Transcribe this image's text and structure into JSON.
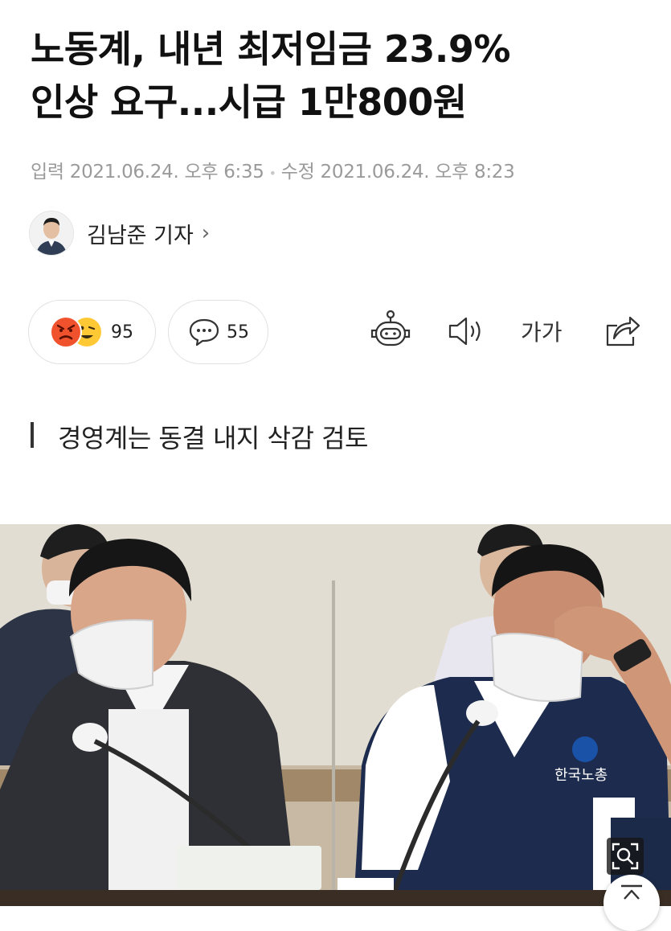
{
  "article": {
    "title_line1": "노동계, 내년 최저임금 23.9%",
    "title_line2": "인상 요구...시급 1만800원",
    "meta": {
      "input_label": "입력",
      "input_time": "2021.06.24. 오후 6:35",
      "edit_label": "수정",
      "edit_time": "2021.06.24. 오후 8:23"
    },
    "reporter": {
      "name": "김남준 기자",
      "chevron": "›"
    },
    "reactions": {
      "count": "95"
    },
    "comments": {
      "count": "55"
    },
    "toolbar": {
      "font_size_label": "가가"
    },
    "subtitle": "경영계는 동결 내지 삭감 검토",
    "photo_text": {
      "vest_logo": "한국노총"
    }
  },
  "colors": {
    "angry": "#f0522e",
    "smile": "#ffc936",
    "meta_gray": "#9a9a9a"
  },
  "icons": [
    "angry-emoji-icon",
    "smile-emoji-icon",
    "comment-icon",
    "robot-icon",
    "speaker-icon",
    "font-size-icon",
    "share-icon",
    "zoom-icon",
    "top-arrow-icon"
  ]
}
